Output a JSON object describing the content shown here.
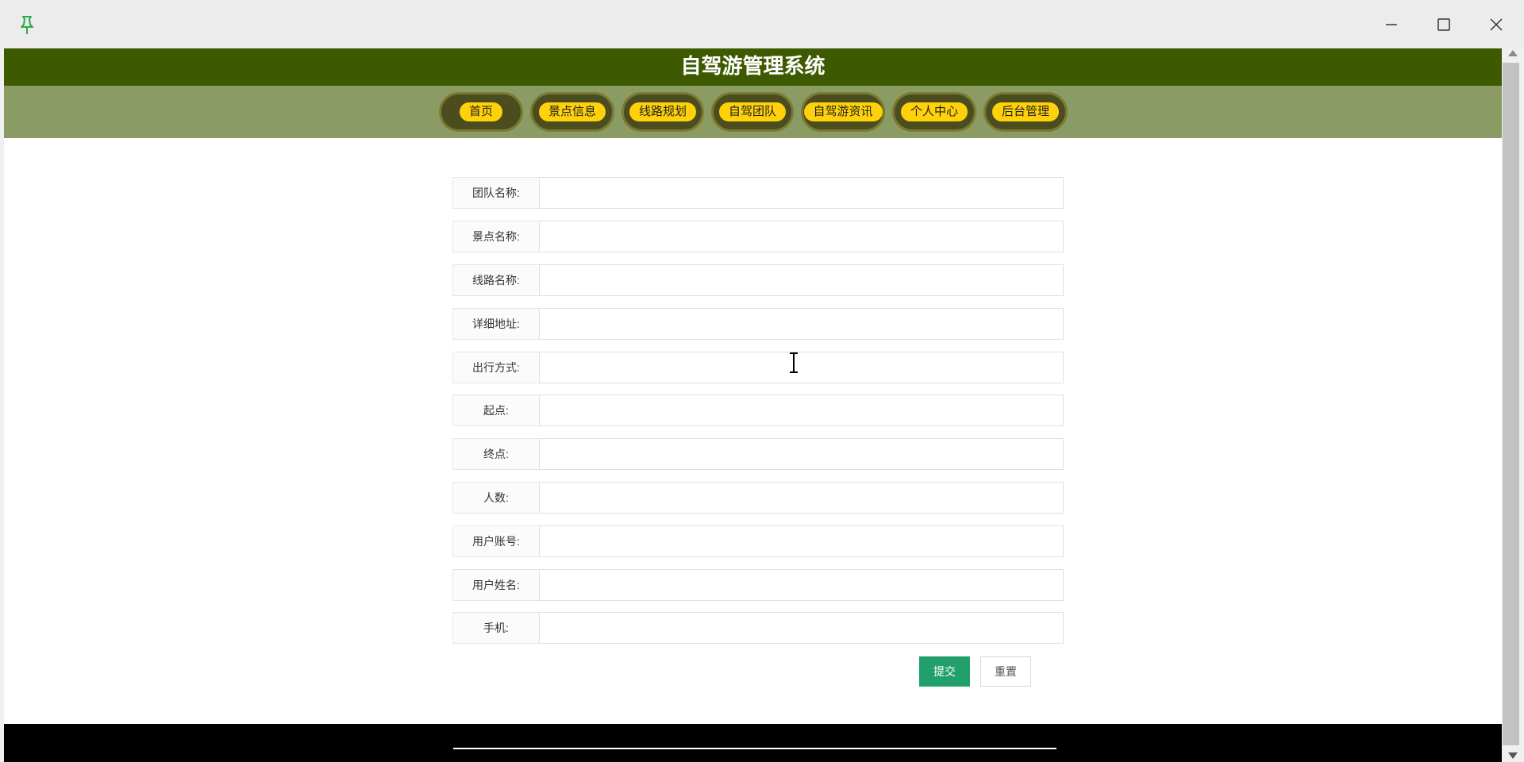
{
  "site": {
    "title": "自驾游管理系统"
  },
  "nav": [
    {
      "label": "首页"
    },
    {
      "label": "景点信息"
    },
    {
      "label": "线路规划"
    },
    {
      "label": "自驾团队"
    },
    {
      "label": "自驾游资讯"
    },
    {
      "label": "个人中心"
    },
    {
      "label": "后台管理"
    }
  ],
  "form": {
    "fields": [
      {
        "label": "团队名称:",
        "value": ""
      },
      {
        "label": "景点名称:",
        "value": ""
      },
      {
        "label": "线路名称:",
        "value": ""
      },
      {
        "label": "详细地址:",
        "value": ""
      },
      {
        "label": "出行方式:",
        "value": ""
      },
      {
        "label": "起点:",
        "value": ""
      },
      {
        "label": "终点:",
        "value": ""
      },
      {
        "label": "人数:",
        "value": ""
      },
      {
        "label": "用户账号:",
        "value": ""
      },
      {
        "label": "用户姓名:",
        "value": ""
      },
      {
        "label": "手机:",
        "value": ""
      }
    ],
    "submit_label": "提交",
    "reset_label": "重置"
  },
  "colors": {
    "header_bg": "#3d5a00",
    "nav_bg": "#8a9c63",
    "nav_pill": "#ffd10a",
    "submit_bg": "#22a06b",
    "footer_bg": "#000000"
  },
  "icons": {
    "pin": "pin-icon",
    "minimize": "minimize-icon",
    "maximize": "maximize-icon",
    "close": "close-icon"
  }
}
